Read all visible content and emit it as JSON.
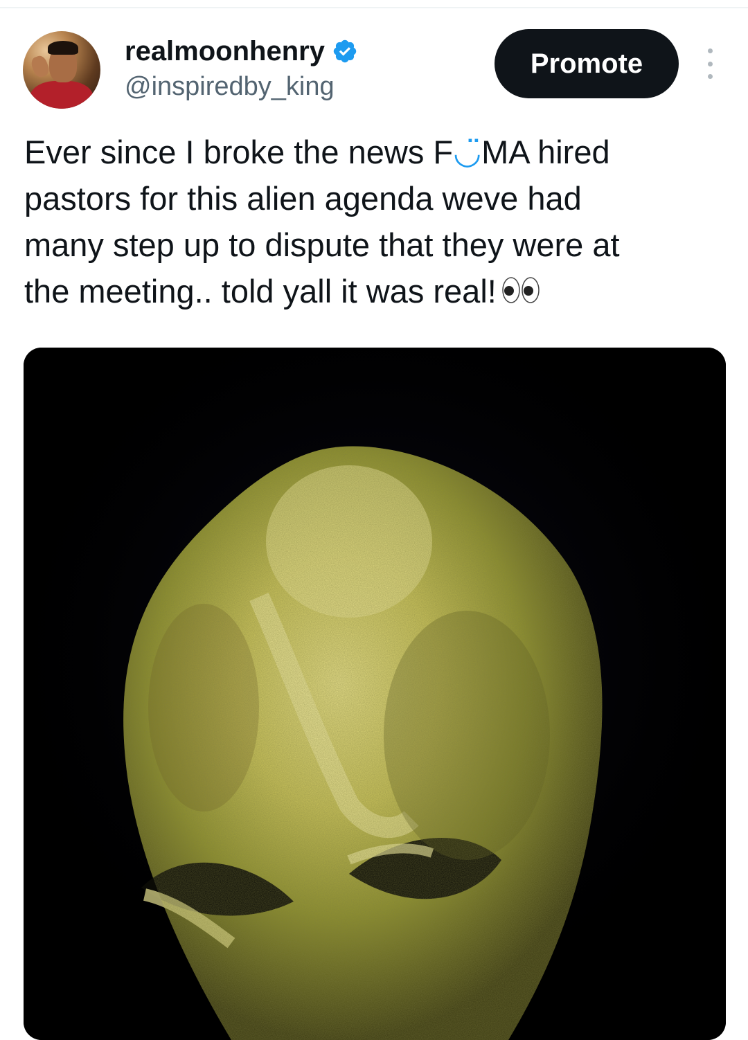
{
  "tweet": {
    "display_name": "realmoonhenry",
    "handle": "@inspiredby_king",
    "verified": true,
    "promote_label": "Promote",
    "text_line_1": "Ever since I broke the news F",
    "text_line_1_emoji": "◡̈",
    "text_line_1_rest": "MA hired",
    "text_line_2": "pastors for this alien agenda weve had",
    "text_line_3": "many step up to dispute that they were at",
    "text_line_4": "the meeting.. told yall it was real!",
    "text_emoji": "eyes-emoji"
  },
  "media": {
    "type": "image",
    "subject": "alien-face-image"
  },
  "colors": {
    "verified_blue": "#1d9bf0",
    "text_primary": "#0f1419",
    "text_secondary": "#536471",
    "button_bg": "#0f1419"
  },
  "icons": {
    "verified": "verified-badge-icon",
    "more": "more-options-icon"
  }
}
